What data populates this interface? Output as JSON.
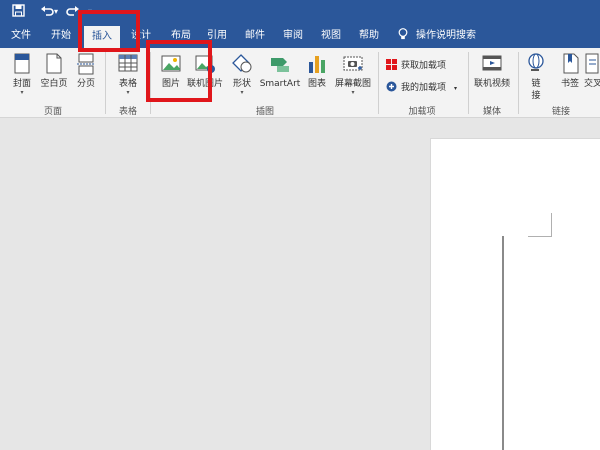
{
  "quick_access": {
    "save_icon": "save-icon",
    "undo_icon": "undo-icon",
    "redo_icon": "redo-icon"
  },
  "tabs": [
    {
      "label": "文件"
    },
    {
      "label": "开始"
    },
    {
      "label": "插入"
    },
    {
      "label": "设计"
    },
    {
      "label": "布局"
    },
    {
      "label": "引用"
    },
    {
      "label": "邮件"
    },
    {
      "label": "审阅"
    },
    {
      "label": "视图"
    },
    {
      "label": "帮助"
    }
  ],
  "active_tab": "插入",
  "tell_me": {
    "label": "操作说明搜索"
  },
  "ribbon": {
    "pages": {
      "cover": "封面",
      "blank": "空白页",
      "break": "分页",
      "group": "页面"
    },
    "tables": {
      "table": "表格",
      "group": "表格"
    },
    "illustrations": {
      "pictures": "图片",
      "online_pictures": "联机图片",
      "shapes": "形状",
      "smartart": "SmartArt",
      "chart": "图表",
      "screenshot": "屏幕截图",
      "group": "插图"
    },
    "addins": {
      "get": "获取加载项",
      "my": "我的加载项",
      "group": "加载项"
    },
    "media": {
      "online_video": "联机视频",
      "group": "媒体"
    },
    "links": {
      "link": "链接",
      "bookmark": "书签",
      "cross_ref": "交叉",
      "group": "链接"
    }
  },
  "colors": {
    "brand": "#2b579a",
    "highlight": "#e0161b"
  }
}
